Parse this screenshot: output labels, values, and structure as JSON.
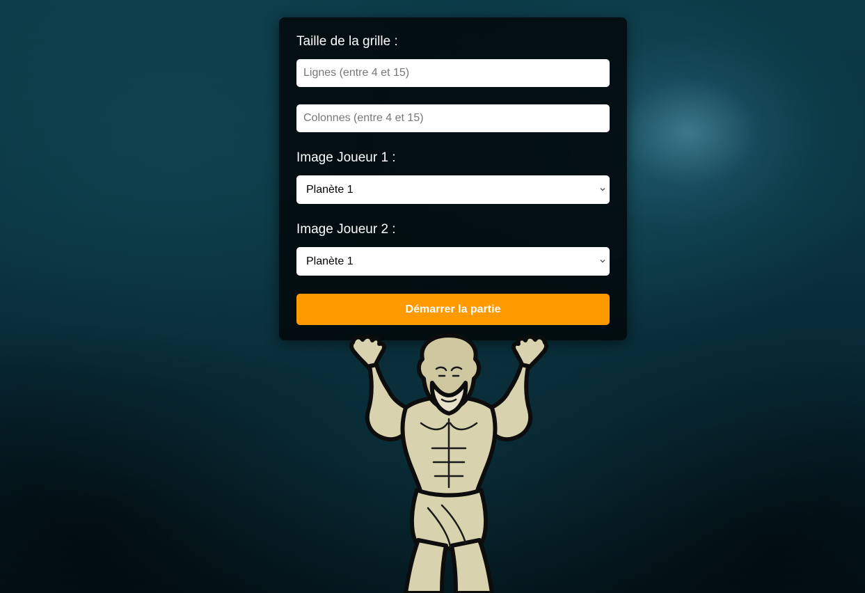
{
  "grid": {
    "label": "Taille de la grille :",
    "rows_placeholder": "Lignes (entre 4 et 15)",
    "cols_placeholder": "Colonnes (entre 4 et 15)"
  },
  "player1": {
    "label": "Image Joueur 1 :",
    "selected": "Planète 1"
  },
  "player2": {
    "label": "Image Joueur 2 :",
    "selected": "Planète 1"
  },
  "start_button": {
    "label": "Démarrer la partie",
    "color": "#ff9900"
  },
  "illustration": {
    "icon": "atlas-figure-icon"
  }
}
